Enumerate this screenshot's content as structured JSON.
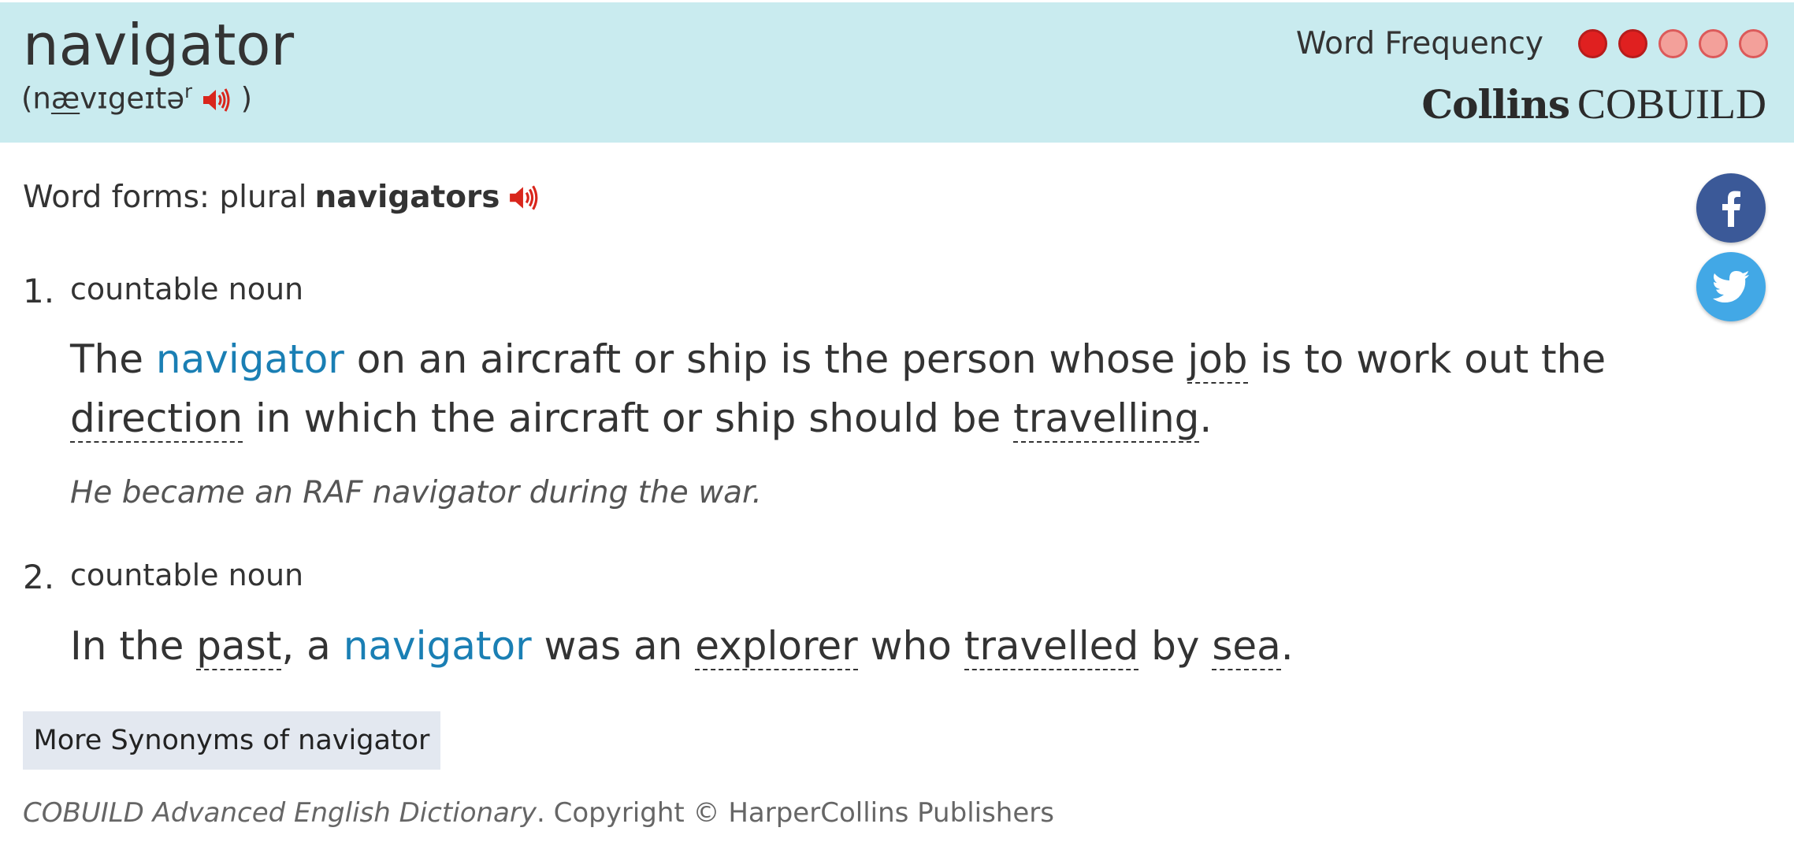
{
  "entry": {
    "headword": "navigator",
    "pron_open": "(n",
    "pron_stressed": "æ",
    "pron_rest": "vɪgeɪtə",
    "pron_sup": "r",
    "pron_close": ")"
  },
  "frequency": {
    "label": "Word Frequency",
    "filled": 2,
    "total": 5,
    "filled_color": "#e02020",
    "empty_color": "#f3a09a"
  },
  "brand": {
    "name1": "Collins",
    "name2": "COBUILD"
  },
  "word_forms": {
    "label": "Word forms: plural",
    "form": "navigators"
  },
  "senses": [
    {
      "number": "1.",
      "pos": "countable noun",
      "def": {
        "t1": "The",
        "hw": "navigator",
        "t2": "on an aircraft or ship is the person whose",
        "x1": "job",
        "t3": "is to work out the",
        "x2": "direction",
        "t4": "in which the aircraft or ship should be",
        "x3": "travelling",
        "t5": "."
      },
      "example": "He became an RAF navigator during the war."
    },
    {
      "number": "2.",
      "pos": "countable noun",
      "def": {
        "t1": "In the",
        "x1": "past",
        "t2": ", a",
        "hw": "navigator",
        "t3": "was an",
        "x2": "explorer",
        "t4": "who",
        "x3": "travelled",
        "t5": "by",
        "x4": "sea",
        "t6": "."
      }
    }
  ],
  "synonyms_button": "More Synonyms of navigator",
  "copyright": {
    "source": "COBUILD Advanced English Dictionary",
    "rest": ". Copyright © HarperCollins Publishers"
  },
  "icons": {
    "audio": "speaker-icon",
    "facebook": "facebook-icon",
    "twitter": "twitter-icon"
  }
}
